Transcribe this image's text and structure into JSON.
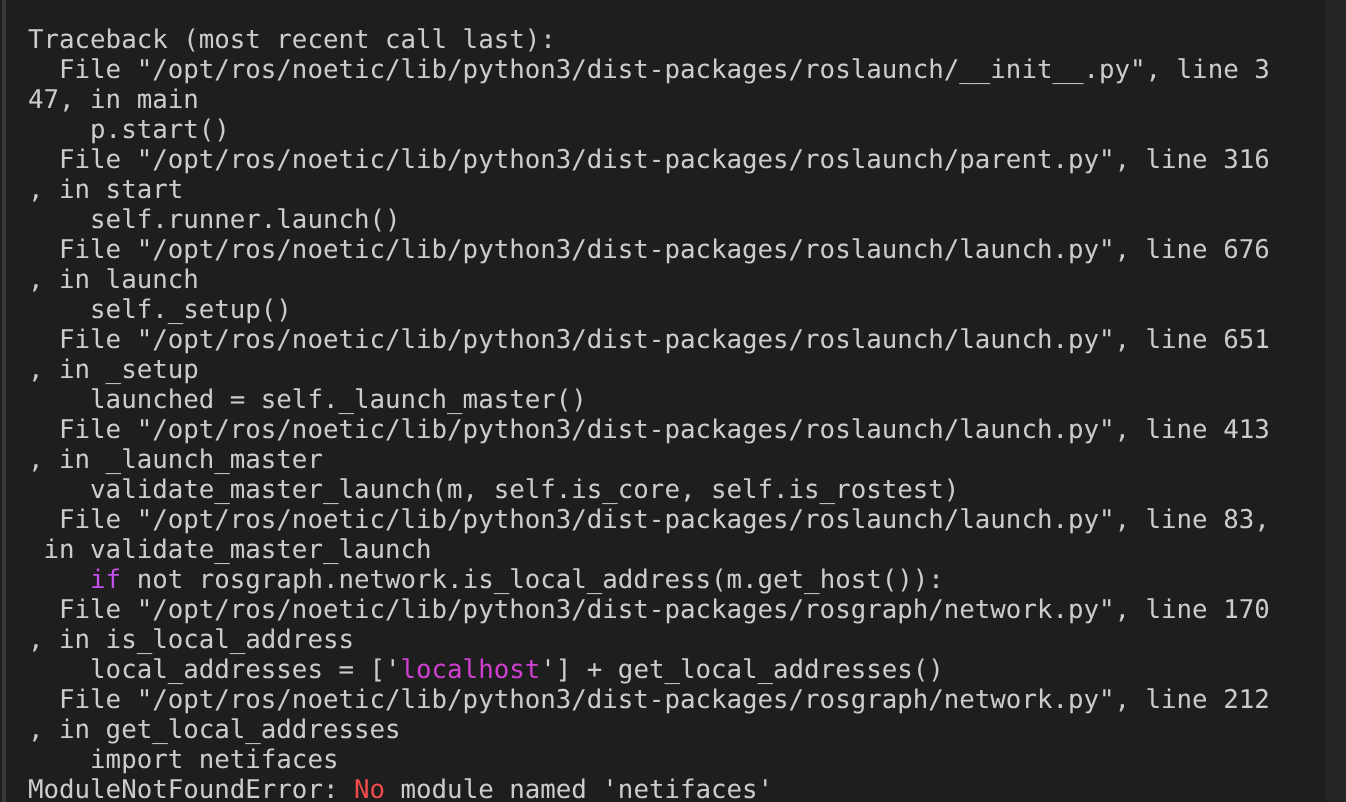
{
  "terminal": {
    "lines": [
      {
        "parts": [
          {
            "text": "Traceback (most recent call last):",
            "kind": "plain"
          }
        ]
      },
      {
        "parts": [
          {
            "text": "  File \"/opt/ros/noetic/lib/python3/dist-packages/roslaunch/__init__.py\", line 3",
            "kind": "plain"
          }
        ]
      },
      {
        "parts": [
          {
            "text": "47, in main",
            "kind": "plain"
          }
        ]
      },
      {
        "parts": [
          {
            "text": "    p.start()",
            "kind": "plain"
          }
        ]
      },
      {
        "parts": [
          {
            "text": "  File \"/opt/ros/noetic/lib/python3/dist-packages/roslaunch/parent.py\", line 316",
            "kind": "plain"
          }
        ]
      },
      {
        "parts": [
          {
            "text": ", in start",
            "kind": "plain"
          }
        ]
      },
      {
        "parts": [
          {
            "text": "    self.runner.launch()",
            "kind": "plain"
          }
        ]
      },
      {
        "parts": [
          {
            "text": "  File \"/opt/ros/noetic/lib/python3/dist-packages/roslaunch/launch.py\", line 676",
            "kind": "plain"
          }
        ]
      },
      {
        "parts": [
          {
            "text": ", in launch",
            "kind": "plain"
          }
        ]
      },
      {
        "parts": [
          {
            "text": "    self._setup()",
            "kind": "plain"
          }
        ]
      },
      {
        "parts": [
          {
            "text": "  File \"/opt/ros/noetic/lib/python3/dist-packages/roslaunch/launch.py\", line 651",
            "kind": "plain"
          }
        ]
      },
      {
        "parts": [
          {
            "text": ", in _setup",
            "kind": "plain"
          }
        ]
      },
      {
        "parts": [
          {
            "text": "    launched = self._launch_master()",
            "kind": "plain"
          }
        ]
      },
      {
        "parts": [
          {
            "text": "  File \"/opt/ros/noetic/lib/python3/dist-packages/roslaunch/launch.py\", line 413",
            "kind": "plain"
          }
        ]
      },
      {
        "parts": [
          {
            "text": ", in _launch_master",
            "kind": "plain"
          }
        ]
      },
      {
        "parts": [
          {
            "text": "    validate_master_launch(m, self.is_core, self.is_rostest)",
            "kind": "plain"
          }
        ]
      },
      {
        "parts": [
          {
            "text": "  File \"/opt/ros/noetic/lib/python3/dist-packages/roslaunch/launch.py\", line 83,",
            "kind": "plain"
          }
        ]
      },
      {
        "parts": [
          {
            "text": " in validate_master_launch",
            "kind": "plain"
          }
        ]
      },
      {
        "parts": [
          {
            "text": "    if",
            "kind": "keyword"
          },
          {
            "text": " not rosgraph.network.is_local_address(m.get_host()):",
            "kind": "plain"
          }
        ]
      },
      {
        "parts": [
          {
            "text": "  File \"/opt/ros/noetic/lib/python3/dist-packages/rosgraph/network.py\", line 170",
            "kind": "plain"
          }
        ]
      },
      {
        "parts": [
          {
            "text": ", in is_local_address",
            "kind": "plain"
          }
        ]
      },
      {
        "parts": [
          {
            "text": "    local_addresses = ['",
            "kind": "plain"
          },
          {
            "text": "localhost",
            "kind": "string"
          },
          {
            "text": "'] + get_local_addresses()",
            "kind": "plain"
          }
        ]
      },
      {
        "parts": [
          {
            "text": "  File \"/opt/ros/noetic/lib/python3/dist-packages/rosgraph/network.py\", line 212",
            "kind": "plain"
          }
        ]
      },
      {
        "parts": [
          {
            "text": ", in get_local_addresses",
            "kind": "plain"
          }
        ]
      },
      {
        "parts": [
          {
            "text": "    import netifaces",
            "kind": "plain"
          }
        ]
      },
      {
        "parts": [
          {
            "text": "ModuleNotFoundError: ",
            "kind": "plain"
          },
          {
            "text": "No",
            "kind": "error"
          },
          {
            "text": " module named 'netifaces'",
            "kind": "plain"
          }
        ]
      }
    ]
  }
}
